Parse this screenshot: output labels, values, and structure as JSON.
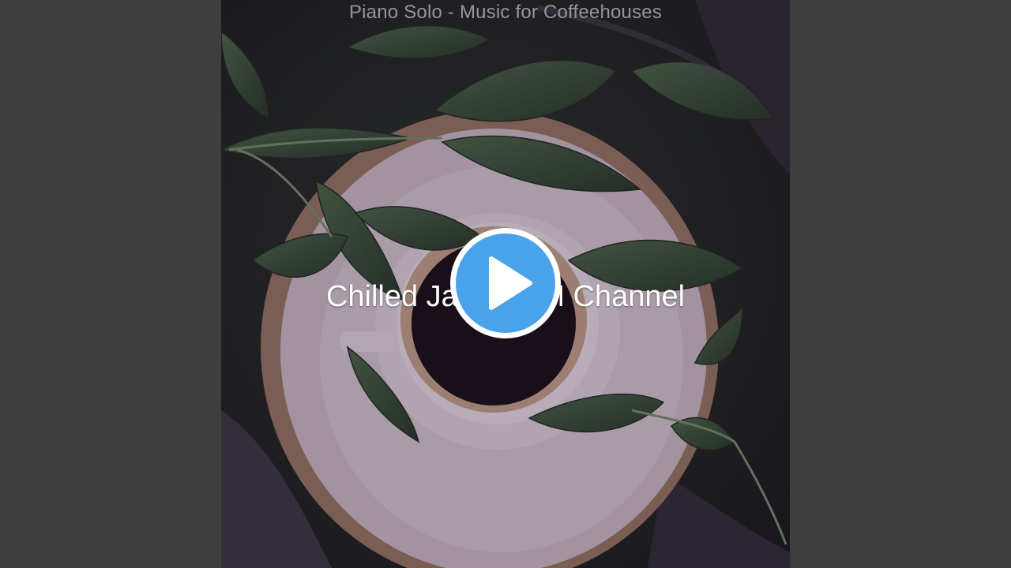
{
  "cover": {
    "top_text": "Piano Solo - Music for Coffeehouses",
    "center_text": "Chilled Jazz BGM Channel"
  },
  "player": {
    "play_icon": "play-icon",
    "accent": "#4aa3ea"
  },
  "colors": {
    "side_background": "#3e3e3e",
    "leaf": "#2f4a2f",
    "tray": "#cdbfc7",
    "coffee": "#120d0f"
  }
}
